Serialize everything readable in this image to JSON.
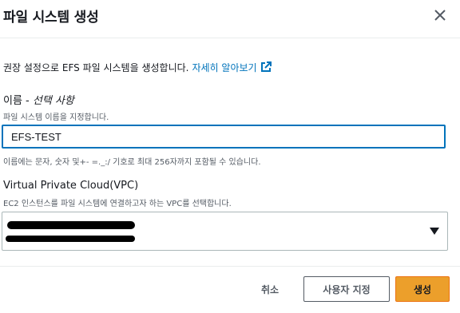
{
  "dialog": {
    "title": "파일 시스템 생성",
    "close_icon": "close-icon"
  },
  "intro": {
    "text": "권장 설정으로 EFS 파일 시스템을 생성합니다.",
    "link_text": "자세히 알아보기",
    "link_icon": "external-link-icon"
  },
  "name_field": {
    "label": "이름 - ",
    "optional_label": "선택 사항",
    "description": "파일 시스템 이름을 지정합니다.",
    "value": "EFS-TEST",
    "constraint": "이름에는 문자, 숫자 및+- =._:/ 기호로 최대 256자까지 포함될 수 있습니다."
  },
  "vpc_field": {
    "label": "Virtual Private Cloud(VPC)",
    "description": "EC2 인스턴스를 파일 시스템에 연결하고자 하는 VPC를 선택합니다.",
    "value_redacted": true,
    "caret_icon": "caret-down-icon"
  },
  "footer": {
    "cancel_label": "취소",
    "customize_label": "사용자 지정",
    "create_label": "생성"
  },
  "colors": {
    "primary_button": "#ec9f2b",
    "link": "#0073bb",
    "focus_border": "#0073bb"
  }
}
